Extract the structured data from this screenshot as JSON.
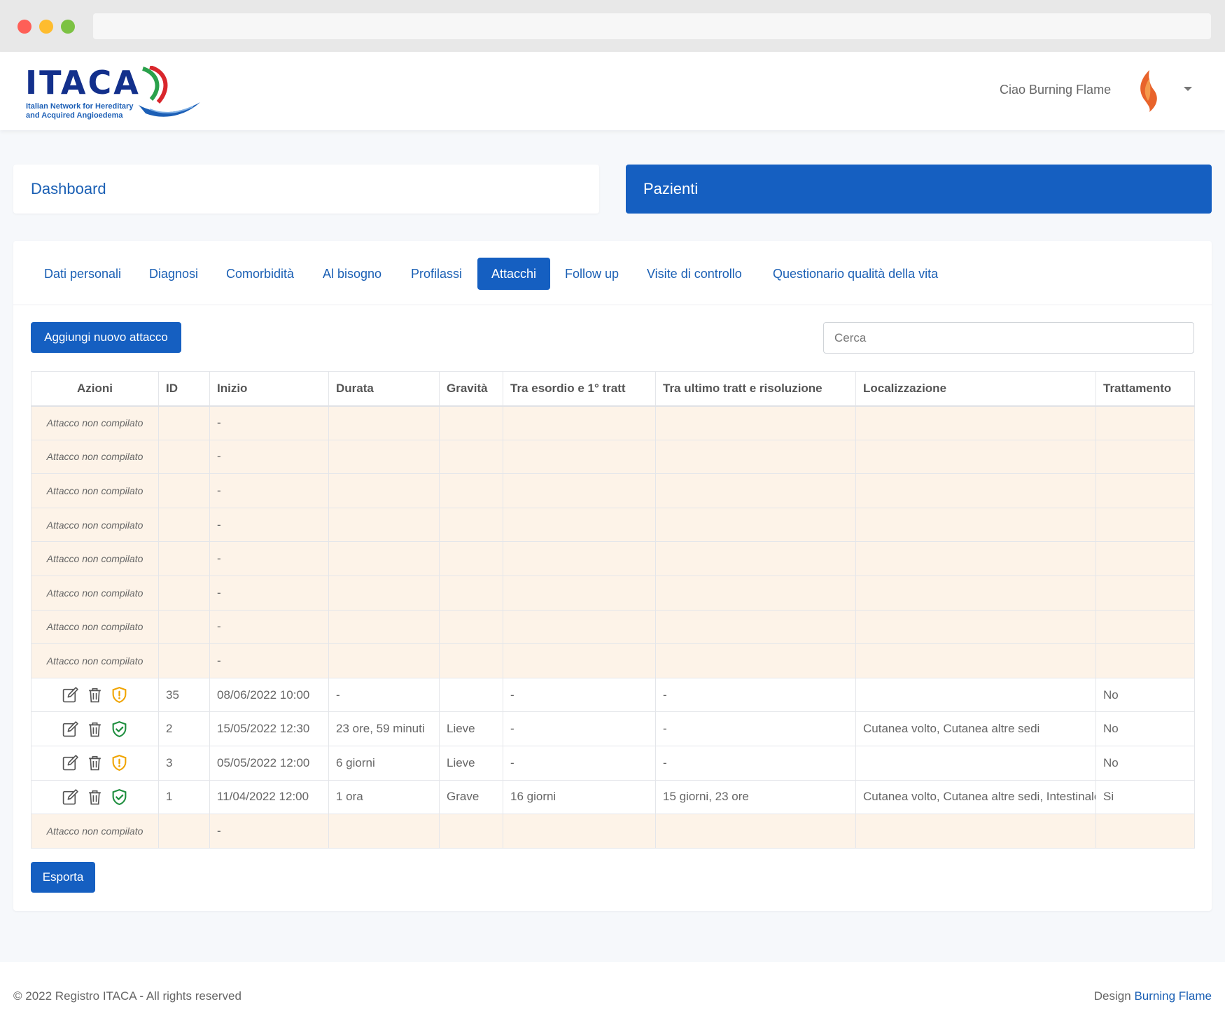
{
  "header": {
    "logo_text": "ITACA",
    "logo_subtitle_line1": "Italian Network for Hereditary",
    "logo_subtitle_line2": "and Acquired Angioedema",
    "greeting": "Ciao Burning Flame"
  },
  "nav": {
    "dashboard": "Dashboard",
    "pazienti": "Pazienti"
  },
  "tabs": [
    {
      "label": "Dati personali",
      "active": false
    },
    {
      "label": "Diagnosi",
      "active": false
    },
    {
      "label": "Comorbidità",
      "active": false
    },
    {
      "label": "Al bisogno",
      "active": false
    },
    {
      "label": "Profilassi",
      "active": false
    },
    {
      "label": "Attacchi",
      "active": true
    },
    {
      "label": "Follow up",
      "active": false
    },
    {
      "label": "Visite di controllo",
      "active": false
    },
    {
      "label": "Questionario qualità della vita",
      "active": false
    }
  ],
  "toolbar": {
    "add_label": "Aggiungi nuovo attacco",
    "search_placeholder": "Cerca",
    "export_label": "Esporta"
  },
  "table": {
    "columns": [
      "Azioni",
      "ID",
      "Inizio",
      "Durata",
      "Gravità",
      "Tra esordio e 1° tratt",
      "Tra ultimo tratt e risoluzione",
      "Localizzazione",
      "Trattamento"
    ],
    "not_compiled_label": "Attacco non compilato",
    "rows": [
      {
        "compiled": false,
        "inizio": "-"
      },
      {
        "compiled": false,
        "inizio": "-"
      },
      {
        "compiled": false,
        "inizio": "-"
      },
      {
        "compiled": false,
        "inizio": "-"
      },
      {
        "compiled": false,
        "inizio": "-"
      },
      {
        "compiled": false,
        "inizio": "-"
      },
      {
        "compiled": false,
        "inizio": "-"
      },
      {
        "compiled": false,
        "inizio": "-"
      },
      {
        "compiled": true,
        "status": "warning",
        "id": "35",
        "inizio": "08/06/2022 10:00",
        "durata": "-",
        "gravita": "",
        "tra_esordio": "-",
        "tra_ultimo": "-",
        "localizzazione": "",
        "trattamento": "No"
      },
      {
        "compiled": true,
        "status": "ok",
        "id": "2",
        "inizio": "15/05/2022 12:30",
        "durata": "23 ore, 59 minuti",
        "gravita": "Lieve",
        "tra_esordio": "-",
        "tra_ultimo": "-",
        "localizzazione": "Cutanea volto, Cutanea altre sedi",
        "trattamento": "No"
      },
      {
        "compiled": true,
        "status": "warning",
        "id": "3",
        "inizio": "05/05/2022 12:00",
        "durata": "6 giorni",
        "gravita": "Lieve",
        "tra_esordio": "-",
        "tra_ultimo": "-",
        "localizzazione": "",
        "trattamento": "No"
      },
      {
        "compiled": true,
        "status": "ok",
        "id": "1",
        "inizio": "11/04/2022 12:00",
        "durata": "1 ora",
        "gravita": "Grave",
        "tra_esordio": "16 giorni",
        "tra_ultimo": "15 giorni, 23 ore",
        "localizzazione": "Cutanea volto, Cutanea altre sedi, Intestinale",
        "trattamento": "Si"
      },
      {
        "compiled": false,
        "inizio": "-"
      }
    ]
  },
  "footer": {
    "copyright": "© 2022 Registro ITACA - All rights reserved",
    "design_prefix": "Design",
    "design_link": "Burning Flame"
  },
  "colors": {
    "primary": "#155fc1",
    "link": "#1a5fb4",
    "warning_icon": "#f0a400",
    "ok_icon": "#1e8e3e",
    "empty_row_bg": "#fdf3e8"
  },
  "icons": {
    "edit": "edit-icon",
    "delete": "trash-icon",
    "status_ok": "shield-check-icon",
    "status_warning": "shield-alert-icon",
    "avatar": "flame-icon",
    "dropdown": "caret-down-icon"
  }
}
